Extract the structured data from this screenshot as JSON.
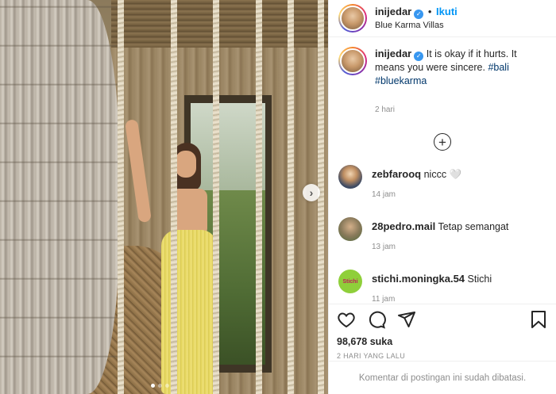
{
  "post": {
    "username": "inijedar",
    "follow_label": "Ikuti",
    "location": "Blue Karma Villas",
    "caption_text": "It is okay if it hurts. It means you were sincere.",
    "hashtags": [
      "#bali",
      "#bluekarma"
    ],
    "caption_time": "2 hari",
    "likes": "98,678 suka",
    "date": "2 HARI YANG LALU",
    "comments_limited": "Komentar di postingan ini sudah dibatasi."
  },
  "comments": [
    {
      "user": "zebfarooq",
      "text": "niccc 🤍",
      "time": "14 jam"
    },
    {
      "user": "28pedro.mail",
      "text": "Tetap semangat",
      "time": "13 jam"
    },
    {
      "user": "stichi.moningka.54",
      "text": "Stichi",
      "time": "11 jam",
      "avatar_text": "Stichi"
    }
  ],
  "carousel": {
    "current": 1,
    "total": 3
  },
  "icons": {
    "like": "heart-icon",
    "comment": "comment-icon",
    "share": "share-icon",
    "save": "bookmark-icon",
    "load_more": "plus-circle-icon",
    "next": "chevron-right-icon",
    "verified": "verified-badge-icon"
  },
  "colors": {
    "accent": "#0095f6",
    "hashtag": "#00376b",
    "muted": "#8e8e8e",
    "verified": "#3897f0"
  }
}
